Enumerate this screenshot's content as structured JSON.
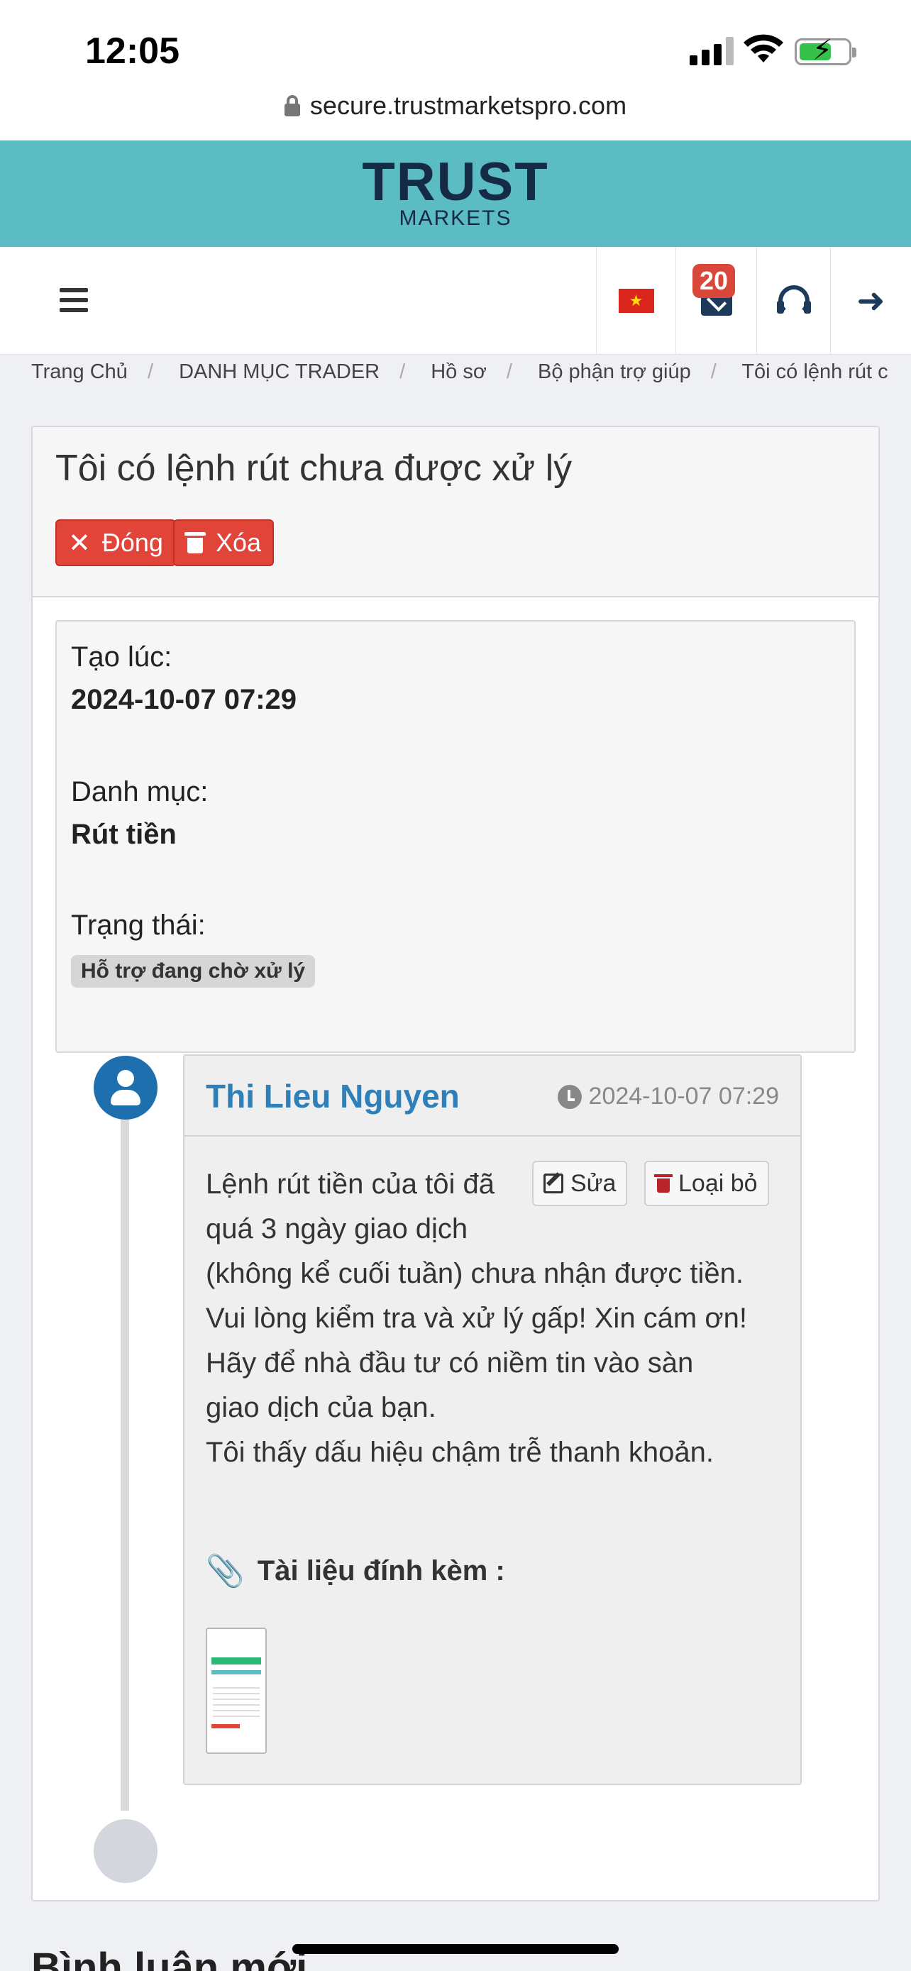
{
  "status_bar": {
    "time": "12:05"
  },
  "browser": {
    "url": "secure.trustmarketspro.com"
  },
  "brand": {
    "line1": "TRUST",
    "line2": "MARKETS"
  },
  "navbar": {
    "notification_count": "20"
  },
  "breadcrumb": [
    "Trang Chủ",
    "DANH MỤC TRADER",
    "Hồ sơ",
    "Bộ phận trợ giúp",
    "Tôi có lệnh rút c"
  ],
  "ticket": {
    "title": "Tôi có lệnh rút chưa được xử lý",
    "close_label": "Đóng",
    "delete_label": "Xóa",
    "created_label": "Tạo lúc:",
    "created_value": "2024-10-07 07:29",
    "category_label": "Danh mục:",
    "category_value": "Rút tiền",
    "status_label": "Trạng thái:",
    "status_value": "Hỗ trợ đang chờ xử lý"
  },
  "message": {
    "author": "Thi Lieu Nguyen",
    "time": "2024-10-07 07:29",
    "edit_label": "Sửa",
    "remove_label": "Loại bỏ",
    "lines": [
      "Lệnh rút tiền của tôi đã",
      "quá 3 ngày giao dịch",
      "(không kể cuối tuần) chưa nhận được tiền.",
      "Vui lòng kiểm tra và xử lý gấp! Xin cám ơn!",
      "Hãy để nhà đầu tư có niềm tin vào sàn",
      "giao dịch của bạn.",
      "Tôi thấy dấu hiệu chậm trễ thanh khoản."
    ],
    "attachments_label": "Tài liệu đính kèm :"
  },
  "comments": {
    "title": "Bình luận mới"
  },
  "colors": {
    "brand_bar": "#5bbcc4",
    "danger": "#e1453a",
    "author": "#2f80b8"
  }
}
